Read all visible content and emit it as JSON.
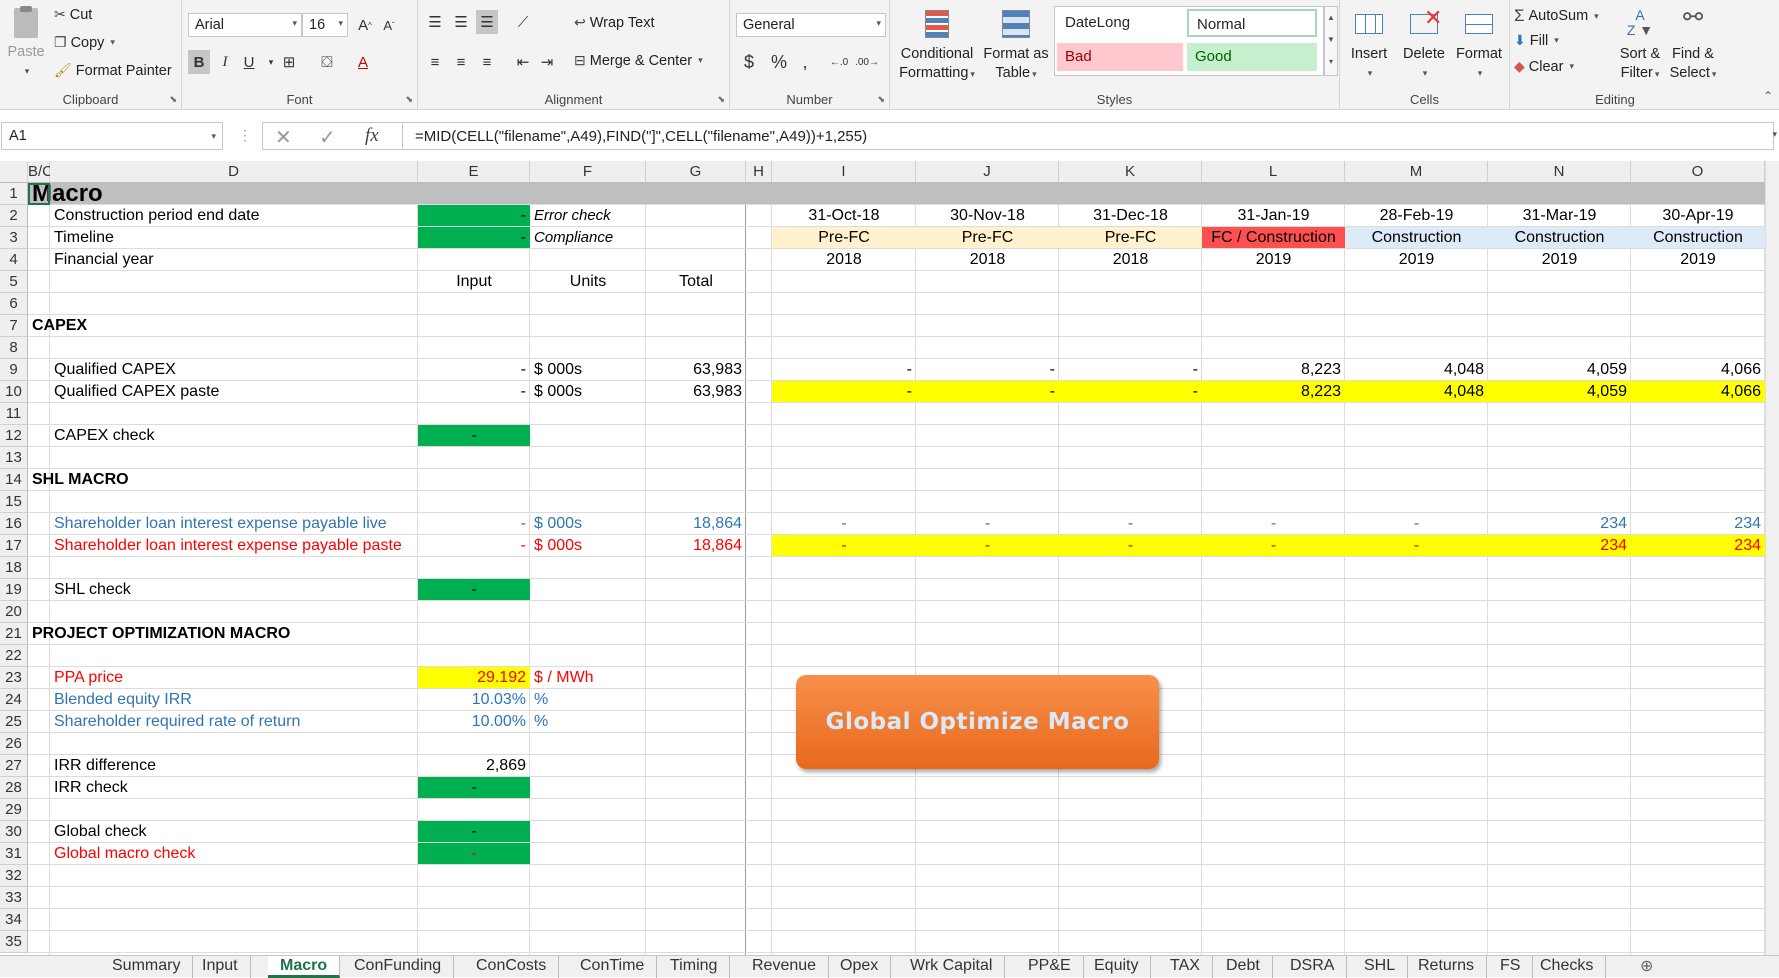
{
  "ribbon": {
    "clipboard": {
      "label": "Clipboard",
      "paste": "Paste",
      "cut": "Cut",
      "copy": "Copy",
      "format_painter": "Format Painter"
    },
    "font": {
      "label": "Font",
      "name": "Arial",
      "size": "16"
    },
    "alignment": {
      "label": "Alignment",
      "wrap_text": "Wrap Text",
      "merge_center": "Merge & Center"
    },
    "number": {
      "label": "Number",
      "format": "General"
    },
    "styles": {
      "label": "Styles",
      "conditional": "Conditional",
      "formatting": "Formatting",
      "format_as": "Format as",
      "table": "Table",
      "datelong": "DateLong",
      "normal": "Normal",
      "bad": "Bad",
      "good": "Good"
    },
    "cells": {
      "label": "Cells",
      "insert": "Insert",
      "delete": "Delete",
      "format": "Format"
    },
    "editing": {
      "label": "Editing",
      "autosum": "AutoSum",
      "fill": "Fill",
      "clear": "Clear",
      "sort1": "Sort &",
      "sort2": "Filter",
      "find1": "Find &",
      "find2": "Select"
    }
  },
  "formula_bar": {
    "name_box": "A1",
    "formula": "=MID(CELL(\"filename\",A49),FIND(\"]\",CELL(\"filename\",A49))+1,255)"
  },
  "columns": [
    "B/C",
    "D",
    "E",
    "F",
    "G",
    "H",
    "I",
    "J",
    "K",
    "L",
    "M",
    "N",
    "O"
  ],
  "rows": [
    "1",
    "2",
    "3",
    "4",
    "5",
    "6",
    "7",
    "8",
    "9",
    "10",
    "11",
    "12",
    "13",
    "14",
    "15",
    "16",
    "17",
    "18",
    "19",
    "20",
    "21",
    "22",
    "23",
    "24",
    "25",
    "26",
    "27",
    "28",
    "29",
    "30",
    "31",
    "32",
    "33",
    "34",
    "35"
  ],
  "sheet": {
    "title": "Macro",
    "construction_end": "Construction period end date",
    "timeline": "Timeline",
    "financial_year": "Financial year",
    "dash": "-",
    "error_check": "Error check",
    "compliance": "Compliance",
    "input_hdr": "Input",
    "units_hdr": "Units",
    "total_hdr": "Total",
    "dates": [
      "31-Oct-18",
      "30-Nov-18",
      "31-Dec-18",
      "31-Jan-19",
      "28-Feb-19",
      "31-Mar-19",
      "30-Apr-19"
    ],
    "phases": [
      "Pre-FC",
      "Pre-FC",
      "Pre-FC",
      "FC / Construction",
      "Construction",
      "Construction",
      "Construction"
    ],
    "years": [
      "2018",
      "2018",
      "2018",
      "2019",
      "2019",
      "2019",
      "2019"
    ],
    "capex": "CAPEX",
    "q_capex": "Qualified CAPEX",
    "q_capex_paste": "Qualified CAPEX paste",
    "usd000": "$ 000s",
    "capex_total": "63,983",
    "capex_vals": [
      "-",
      "-",
      "-",
      "8,223",
      "4,048",
      "4,059",
      "4,066"
    ],
    "capex_check": "CAPEX check",
    "shl_macro": "SHL MACRO",
    "shl_live": "Shareholder loan interest expense payable live",
    "shl_paste": "Shareholder loan interest expense payable paste",
    "shl_total": "18,864",
    "shl_vals": [
      "-",
      "-",
      "-",
      "-",
      "-",
      "234",
      "234"
    ],
    "shl_check": "SHL check",
    "proj_opt": "PROJECT OPTIMIZATION MACRO",
    "ppa_price": "PPA price",
    "ppa_val": "29.192",
    "ppa_unit": "$ / MWh",
    "blended_irr": "Blended equity IRR",
    "blended_val": "10.03%",
    "pct": "%",
    "req_return": "Shareholder required rate of return",
    "req_val": "10.00%",
    "irr_diff": "IRR difference",
    "irr_diff_val": "2,869",
    "irr_check": "IRR check",
    "global_check": "Global check",
    "global_macro_check": "Global macro check"
  },
  "macro_button": "Global Optimize Macro",
  "tabs": [
    "Summary",
    "Input",
    "Macro",
    "ConFunding",
    "ConCosts",
    "ConTime",
    "Timing",
    "Revenue",
    "Opex",
    "Wrk Capital",
    "PP&E",
    "Equity",
    "TAX",
    "Debt",
    "DSRA",
    "SHL",
    "Returns",
    "FS",
    "Checks"
  ],
  "colors": {
    "green": "#00b050",
    "yellow": "#ffff00",
    "phase_prefc": "#fff2cc",
    "phase_fc": "#ff5050",
    "phase_con": "#ddebf7",
    "button": "#ed7d31"
  }
}
